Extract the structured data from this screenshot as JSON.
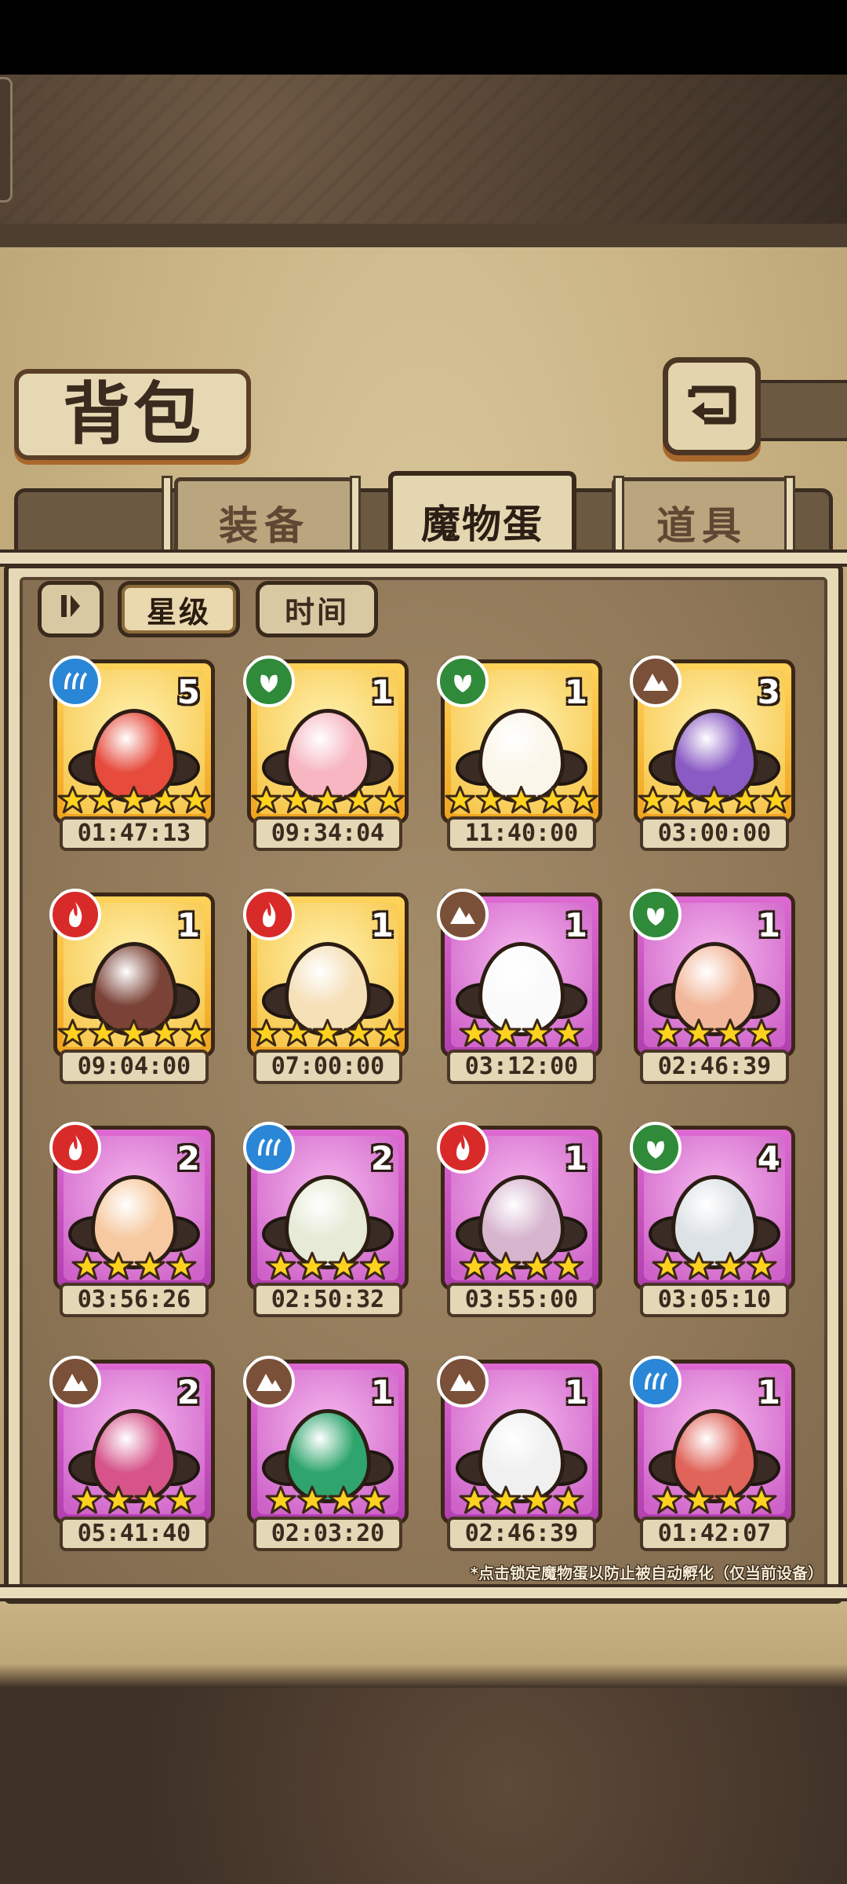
{
  "header": {
    "title": "背包",
    "back_icon": "back-arrow-icon"
  },
  "tabs": [
    {
      "label": "装备",
      "active": false
    },
    {
      "label": "魔物蛋",
      "active": true
    },
    {
      "label": "道具",
      "active": false
    }
  ],
  "filters": {
    "toggle_icon": "sort-toggle-icon",
    "sort_star": "星级",
    "sort_time": "时间",
    "active": "星级"
  },
  "eggs": [
    {
      "element": "water",
      "count": "5",
      "stars": 5,
      "rarity": "gold",
      "timer": "01:47:13",
      "color": "#e64b3c"
    },
    {
      "element": "nature",
      "count": "1",
      "stars": 5,
      "rarity": "gold",
      "timer": "09:34:04",
      "color": "#f7b6c2"
    },
    {
      "element": "nature",
      "count": "1",
      "stars": 5,
      "rarity": "gold",
      "timer": "11:40:00",
      "color": "#fbf6ea"
    },
    {
      "element": "earth",
      "count": "3",
      "stars": 5,
      "rarity": "gold",
      "timer": "03:00:00",
      "color": "#8a5bc4"
    },
    {
      "element": "fire",
      "count": "1",
      "stars": 5,
      "rarity": "gold",
      "timer": "09:04:00",
      "color": "#7b4338"
    },
    {
      "element": "fire",
      "count": "1",
      "stars": 5,
      "rarity": "gold",
      "timer": "07:00:00",
      "color": "#f5e0b8"
    },
    {
      "element": "earth",
      "count": "1",
      "stars": 4,
      "rarity": "purple",
      "timer": "03:12:00",
      "color": "#fafafa"
    },
    {
      "element": "nature",
      "count": "1",
      "stars": 4,
      "rarity": "purple",
      "timer": "02:46:39",
      "color": "#f2b79a"
    },
    {
      "element": "fire",
      "count": "2",
      "stars": 4,
      "rarity": "purple",
      "timer": "03:56:26",
      "color": "#f6c9a0"
    },
    {
      "element": "water",
      "count": "2",
      "stars": 4,
      "rarity": "purple",
      "timer": "02:50:32",
      "color": "#e7ead6"
    },
    {
      "element": "fire",
      "count": "1",
      "stars": 4,
      "rarity": "purple",
      "timer": "03:55:00",
      "color": "#d7b5cf"
    },
    {
      "element": "nature",
      "count": "4",
      "stars": 4,
      "rarity": "purple",
      "timer": "03:05:10",
      "color": "#dde2e6"
    },
    {
      "element": "earth",
      "count": "2",
      "stars": 4,
      "rarity": "purple",
      "timer": "05:41:40",
      "color": "#d6548a"
    },
    {
      "element": "earth",
      "count": "1",
      "stars": 4,
      "rarity": "purple",
      "timer": "02:03:20",
      "color": "#2fa56d"
    },
    {
      "element": "earth",
      "count": "1",
      "stars": 4,
      "rarity": "purple",
      "timer": "02:46:39",
      "color": "#f0f0f0"
    },
    {
      "element": "water",
      "count": "1",
      "stars": 4,
      "rarity": "purple",
      "timer": "01:42:07",
      "color": "#e0645a"
    }
  ],
  "element_colors": {
    "water": "#2a86d6",
    "nature": "#2f8a3a",
    "fire": "#d92a2a",
    "earth": "#7a5038"
  },
  "hint": "*点击锁定魔物蛋以防止被自动孵化（仅当前设备）"
}
